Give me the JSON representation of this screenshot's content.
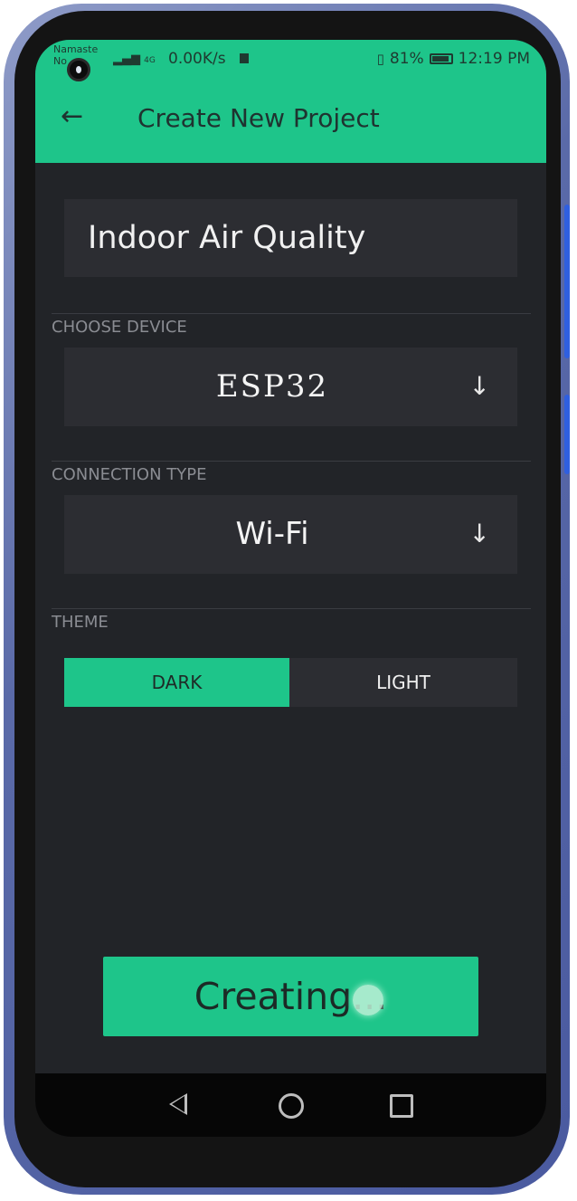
{
  "status_bar": {
    "carrier": "Namaste No",
    "network": "4G",
    "speed": "0.00K/s",
    "battery": "81%",
    "time": "12:19 PM"
  },
  "app_bar": {
    "title": "Create New Project"
  },
  "form": {
    "project_name": "Indoor Air Quality",
    "choose_device_label": "CHOOSE DEVICE",
    "device_value": "ESP32",
    "connection_type_label": "CONNECTION TYPE",
    "connection_value": "Wi-Fi",
    "theme_label": "THEME",
    "theme_options": [
      "DARK",
      "LIGHT"
    ],
    "theme_selected": "DARK"
  },
  "create_button": {
    "label": "Creating..."
  },
  "colors": {
    "accent": "#1ec58a",
    "background": "#222428",
    "field": "#2c2d32",
    "label": "#8a8c92"
  },
  "icons": {
    "back": "arrow-left-icon",
    "dropdown": "arrow-down-icon",
    "nav_back": "triangle-back-icon",
    "nav_home": "circle-home-icon",
    "nav_recent": "square-recent-icon"
  }
}
